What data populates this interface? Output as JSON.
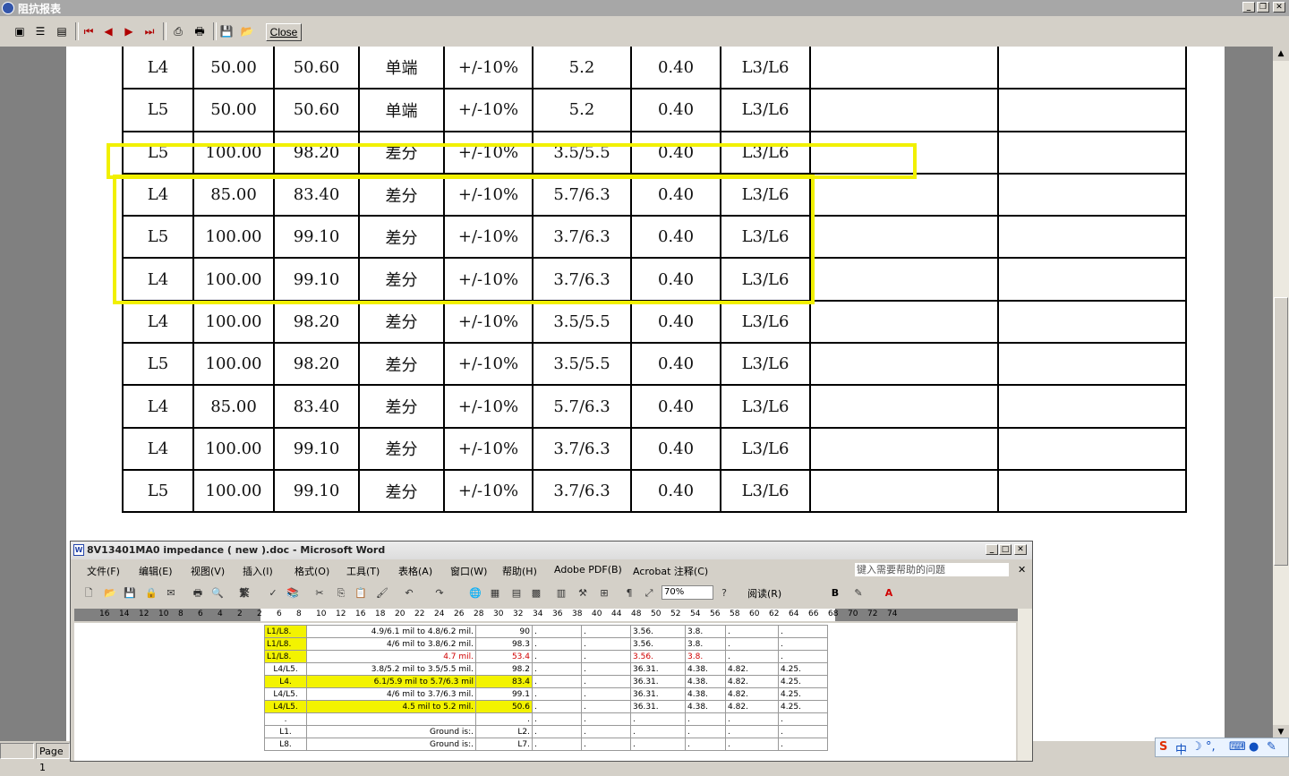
{
  "window": {
    "title": "阻抗报表"
  },
  "toolbar": {
    "close_label": "Close",
    "icons": [
      "page-view-icon",
      "list-view-icon",
      "fit-view-icon",
      "first-page-icon",
      "prev-page-icon",
      "next-page-icon",
      "last-page-icon",
      "print-setup-icon",
      "print-icon",
      "save-icon",
      "open-icon"
    ]
  },
  "report_rows": [
    [
      "L4",
      "50.00",
      "50.60",
      "单端",
      "+/-10%",
      "5.2",
      "0.40",
      "L3/L6",
      "",
      ""
    ],
    [
      "L5",
      "50.00",
      "50.60",
      "单端",
      "+/-10%",
      "5.2",
      "0.40",
      "L3/L6",
      "",
      ""
    ],
    [
      "L5",
      "100.00",
      "98.20",
      "差分",
      "+/-10%",
      "3.5/5.5",
      "0.40",
      "L3/L6",
      "",
      ""
    ],
    [
      "L4",
      "85.00",
      "83.40",
      "差分",
      "+/-10%",
      "5.7/6.3",
      "0.40",
      "L3/L6",
      "",
      ""
    ],
    [
      "L5",
      "100.00",
      "99.10",
      "差分",
      "+/-10%",
      "3.7/6.3",
      "0.40",
      "L3/L6",
      "",
      ""
    ],
    [
      "L4",
      "100.00",
      "99.10",
      "差分",
      "+/-10%",
      "3.7/6.3",
      "0.40",
      "L3/L6",
      "",
      ""
    ],
    [
      "L4",
      "100.00",
      "98.20",
      "差分",
      "+/-10%",
      "3.5/5.5",
      "0.40",
      "L3/L6",
      "",
      ""
    ],
    [
      "L5",
      "100.00",
      "98.20",
      "差分",
      "+/-10%",
      "3.5/5.5",
      "0.40",
      "L3/L6",
      "",
      ""
    ],
    [
      "L4",
      "85.00",
      "83.40",
      "差分",
      "+/-10%",
      "5.7/6.3",
      "0.40",
      "L3/L6",
      "",
      ""
    ],
    [
      "L4",
      "100.00",
      "99.10",
      "差分",
      "+/-10%",
      "3.7/6.3",
      "0.40",
      "L3/L6",
      "",
      ""
    ],
    [
      "L5",
      "100.00",
      "99.10",
      "差分",
      "+/-10%",
      "3.7/6.3",
      "0.40",
      "L3/L6",
      "",
      ""
    ]
  ],
  "status": {
    "page": "Page 1"
  },
  "ime": {
    "lang": "中",
    "moon": "☽",
    "dot": "°,"
  },
  "word": {
    "title": "8V13401MA0 impedance ( new ).doc - Microsoft Word",
    "menu": [
      "文件(F)",
      "编辑(E)",
      "视图(V)",
      "插入(I)",
      "格式(O)",
      "工具(T)",
      "表格(A)",
      "窗口(W)",
      "帮助(H)",
      "Adobe PDF(B)",
      "Acrobat 注释(C)"
    ],
    "help_placeholder": "键入需要帮助的问题",
    "zoom": "70%",
    "read_label": "阅读(R)",
    "trad_label": "繁",
    "ruler": [
      "16",
      "14",
      "12",
      "10",
      "8",
      "6",
      "4",
      "2",
      "2",
      "6",
      "8",
      "10",
      "12",
      "16",
      "18",
      "20",
      "22",
      "24",
      "26",
      "28",
      "30",
      "32",
      "34",
      "36",
      "38",
      "40",
      "44",
      "48",
      "50",
      "52",
      "54",
      "56",
      "58",
      "60",
      "62",
      "64",
      "66",
      "68",
      "70",
      "72",
      "74"
    ],
    "table": [
      [
        "L1/L8.",
        "4.9/6.1 mil to 4.8/6.2 mil.",
        "90",
        ".",
        ".",
        "3.56.",
        "3.8.",
        ".",
        "."
      ],
      [
        "L1/L8.",
        "4/6 mil to 3.8/6.2 mil.",
        "98.3",
        ".",
        ".",
        "3.56.",
        "3.8.",
        ".",
        "."
      ],
      [
        "L1/L8.",
        "4.7 mil.",
        "53.4",
        ".",
        ".",
        "3.56.",
        "3.8.",
        ".",
        "."
      ],
      [
        "L4/L5.",
        "3.8/5.2 mil to 3.5/5.5 mil.",
        "98.2",
        ".",
        ".",
        "36.31.",
        "4.38.",
        "4.82.",
        "4.25."
      ],
      [
        "L4.",
        "6.1/5.9 mil to 5.7/6.3 mil",
        "83.4",
        ".",
        ".",
        "36.31.",
        "4.38.",
        "4.82.",
        "4.25."
      ],
      [
        "L4/L5.",
        "4/6 mil to 3.7/6.3 mil.",
        "99.1",
        ".",
        ".",
        "36.31.",
        "4.38.",
        "4.82.",
        "4.25."
      ],
      [
        "L4/L5.",
        "4.5 mil to 5.2 mil.",
        "50.6",
        ".",
        ".",
        "36.31.",
        "4.38.",
        "4.82.",
        "4.25."
      ],
      [
        ".",
        "",
        ".",
        ".",
        ".",
        ".",
        ".",
        ".",
        "."
      ],
      [
        "L1.",
        "Ground is:.",
        "L2.",
        ".",
        ".",
        ".",
        ".",
        ".",
        "."
      ],
      [
        "L8.",
        "Ground is:.",
        "L7.",
        ".",
        ".",
        ".",
        ".",
        ".",
        "."
      ]
    ]
  }
}
